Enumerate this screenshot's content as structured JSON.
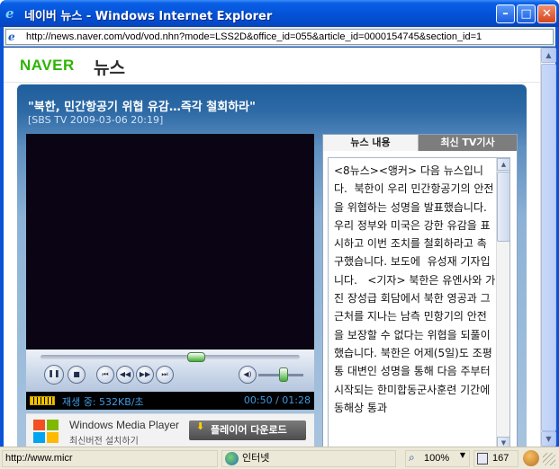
{
  "window": {
    "title": "네이버 뉴스 - Windows Internet Explorer",
    "min_glyph": "–",
    "max_glyph": "□",
    "close_glyph": "✕"
  },
  "address": {
    "url": "http://news.naver.com/vod/vod.nhn?mode=LSS2D&office_id=055&article_id=0000154745&section_id=1"
  },
  "header": {
    "logo": "NAVER",
    "section": "뉴스"
  },
  "article": {
    "headline": "\"북한, 민간항공기 위협 유감…즉각 철회하라\"",
    "source": "[SBS TV 2009-03-06 20:19]",
    "tabs": [
      "뉴스 내용",
      "최신 TV기사"
    ],
    "active_tab": "뉴스 내용",
    "body": "<8뉴스><앵커> 다음 뉴스입니다.  북한이 우리 민간항공기의 안전을 위협하는 성명을 발표했습니다.  우리 정부와 미국은 강한 유감을 표시하고 이번 조치를 철회하라고 촉구했습니다. 보도에  유성재 기자입니다.   <기자> 북한은 유엔사와 가진 장성급 회담에서 북한 영공과 그 근처를 지나는 남측 민항기의 안전을 보장할 수 없다는 위협을 되풀이했습니다. 북한은 어제(5일)도 조평통 대변인 성명을 통해 다음 주부터 시작되는 한미합동군사훈련 기간에 동해상 통과"
  },
  "player": {
    "play_status": "재생 중: 532KB/초",
    "time": "00:50 / 01:28",
    "seek_fraction": 0.6,
    "volume_fraction": 0.55,
    "wmp_name": "Windows Media Player",
    "wmp_sub": "최신버전 설치하기",
    "download_label": "플레이어 다운로드"
  },
  "statusbar": {
    "url": "http://www.micr",
    "zone": "인터넷",
    "zoom": "100%",
    "blocked_count": "167"
  }
}
